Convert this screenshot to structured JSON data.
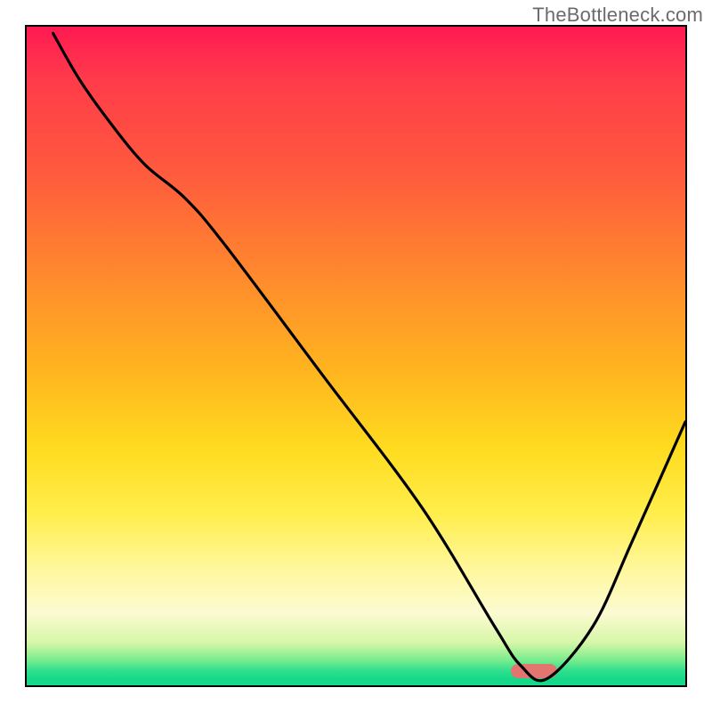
{
  "watermark": "TheBottleneck.com",
  "colors": {
    "gradient_top": "#ff1a52",
    "gradient_bottom": "#16d888",
    "curve": "#000000",
    "marker": "#e2756f",
    "border": "#000000"
  },
  "chart_data": {
    "type": "line",
    "title": "",
    "xlabel": "",
    "ylabel": "",
    "xlim": [
      0,
      100
    ],
    "ylim": [
      0,
      100
    ],
    "grid": false,
    "x": [
      4,
      8,
      13,
      18,
      24,
      30,
      45,
      60,
      71,
      75,
      79,
      86,
      92,
      100
    ],
    "values": [
      99,
      92,
      85,
      79,
      74,
      67,
      47,
      27,
      9,
      3,
      1,
      9,
      22,
      40
    ],
    "notes": "y=0 corresponds to the green baseline at the bottom; y=100 is the top. The curve descends from upper-left, reaches a minimum near x≈78 at the green band, then rises toward the right edge.",
    "marker": {
      "x_center": 77,
      "y": 1,
      "width_pct": 7
    }
  }
}
